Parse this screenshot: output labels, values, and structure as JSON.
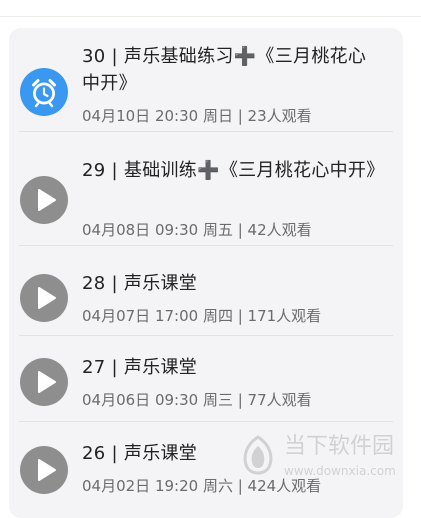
{
  "sessions": [
    {
      "title": "30 | 声乐基础练习➕《三月桃花心中开》",
      "meta": "04月10日 20:30 周日 | 23人观看",
      "icon": "alarm-clock-icon",
      "icon_bg": "#3a98f0"
    },
    {
      "title": "29 | 基础训练➕《三月桃花心中开》",
      "meta": "04月08日 09:30 周五 | 42人观看",
      "icon": "play-icon",
      "icon_bg": "#8e8e8e"
    },
    {
      "title": "28 | 声乐课堂",
      "meta": "04月07日 17:00 周四 | 171人观看",
      "icon": "play-icon",
      "icon_bg": "#8e8e8e"
    },
    {
      "title": "27 | 声乐课堂",
      "meta": "04月06日 09:30 周三 | 77人观看",
      "icon": "play-icon",
      "icon_bg": "#8e8e8e"
    },
    {
      "title": "26 | 声乐课堂",
      "meta": "04月02日 19:20 周六 | 424人观看",
      "icon": "play-icon",
      "icon_bg": "#8e8e8e"
    }
  ],
  "watermark": {
    "name": "当下软件园",
    "url": "www.downxia.com"
  }
}
